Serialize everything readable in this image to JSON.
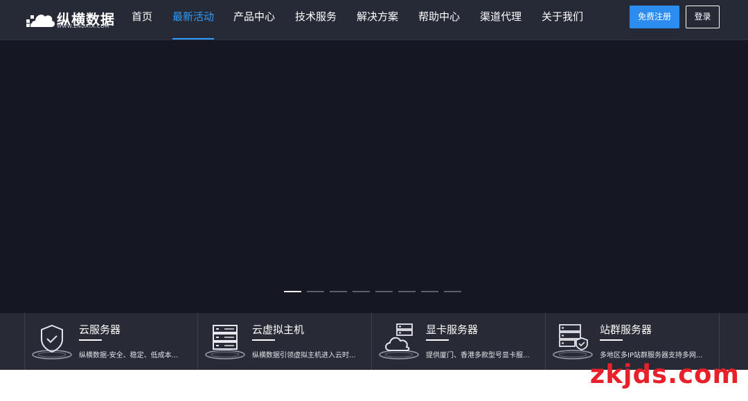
{
  "brand": {
    "name": "纵横数据",
    "domain": "WWW.ZNDATA.COM"
  },
  "nav": {
    "items": [
      {
        "label": "首页"
      },
      {
        "label": "最新活动"
      },
      {
        "label": "产品中心"
      },
      {
        "label": "技术服务"
      },
      {
        "label": "解决方案"
      },
      {
        "label": "帮助中心"
      },
      {
        "label": "渠道代理"
      },
      {
        "label": "关于我们"
      }
    ],
    "active_index": 1
  },
  "header": {
    "register_label": "免费注册",
    "login_label": "登录"
  },
  "banner": {
    "slide_count": 8,
    "active_slide": 1
  },
  "products": [
    {
      "title": "云服务器",
      "desc": "纵横数据-安全、稳定、低成本...",
      "icon": "shield-check-icon"
    },
    {
      "title": "云虚拟主机",
      "desc": "纵横数据引领虚拟主机进入云时...",
      "icon": "server-rack-icon"
    },
    {
      "title": "显卡服务器",
      "desc": "提供厦门、香港多款型号显卡服...",
      "icon": "cloud-server-icon"
    },
    {
      "title": "站群服务器",
      "desc": "多地区多IP站群服务器支持多网...",
      "icon": "server-shield-icon"
    }
  ],
  "watermark": "zkjds.com",
  "colors": {
    "accent": "#2f9bff",
    "header_bg": "#262a36",
    "banner_bg": "#151722",
    "watermark": "#e8202a"
  }
}
